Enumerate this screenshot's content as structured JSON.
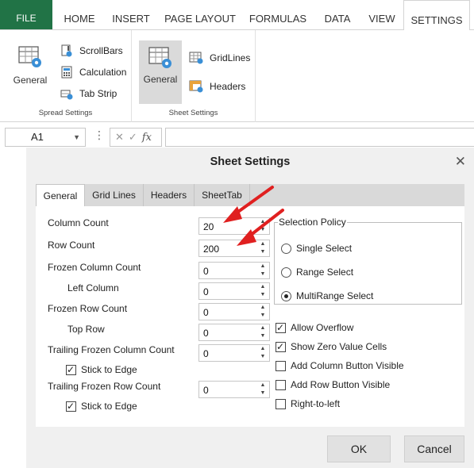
{
  "ribbon_tabs": [
    "FILE",
    "HOME",
    "INSERT",
    "PAGE LAYOUT",
    "FORMULAS",
    "DATA",
    "VIEW",
    "SETTINGS"
  ],
  "active_tab": "SETTINGS",
  "spread_settings": {
    "general": "General",
    "scrollbars": "ScrollBars",
    "calculation": "Calculation",
    "tab_strip": "Tab Strip",
    "group_label": "Spread Settings"
  },
  "sheet_settings": {
    "general": "General",
    "gridlines": "GridLines",
    "headers": "Headers",
    "group_label": "Sheet Settings"
  },
  "formula_bar": {
    "cell_ref": "A1",
    "dots": "⋮",
    "cancel": "✕",
    "enter": "✓",
    "fx": "fx",
    "formula": ""
  },
  "dialog": {
    "title": "Sheet Settings",
    "close": "✕",
    "tabs": [
      "General",
      "Grid Lines",
      "Headers",
      "SheetTab"
    ],
    "active_tab": "General",
    "fields": {
      "column_count": {
        "label": "Column Count",
        "value": "20"
      },
      "row_count": {
        "label": "Row Count",
        "value": "200"
      },
      "frozen_column_count": {
        "label": "Frozen Column Count",
        "value": "0"
      },
      "left_column": {
        "label": "Left Column",
        "value": "0"
      },
      "frozen_row_count": {
        "label": "Frozen Row Count",
        "value": "0"
      },
      "top_row": {
        "label": "Top Row",
        "value": "0"
      },
      "trailing_frozen_column_count": {
        "label": "Trailing Frozen Column Count",
        "value": "0"
      },
      "trailing_frozen_row_count": {
        "label": "Trailing Frozen Row Count",
        "value": "0"
      }
    },
    "stick_to_edge_1": {
      "label": "Stick to Edge",
      "checked": true
    },
    "stick_to_edge_2": {
      "label": "Stick to Edge",
      "checked": true
    },
    "selection_policy": {
      "legend": "Selection Policy",
      "options": [
        "Single Select",
        "Range Select",
        "MultiRange Select"
      ],
      "selected": "MultiRange Select"
    },
    "options": {
      "allow_overflow": {
        "label": "Allow Overflow",
        "checked": true
      },
      "show_zero_value_cells": {
        "label": "Show Zero Value Cells",
        "checked": true
      },
      "add_column_button_visible": {
        "label": "Add Column Button Visible",
        "checked": false
      },
      "add_row_button_visible": {
        "label": "Add Row Button Visible",
        "checked": false
      },
      "right_to_left": {
        "label": "Right-to-left",
        "checked": false
      }
    },
    "ok": "OK",
    "cancel": "Cancel"
  },
  "colors": {
    "file_tab": "#217346",
    "annotation_arrow": "#e02020"
  },
  "icons": [
    "scrollbars-icon",
    "calculation-icon",
    "tab-strip-icon",
    "general-settings-icon",
    "gridlines-icon",
    "headers-icon"
  ]
}
